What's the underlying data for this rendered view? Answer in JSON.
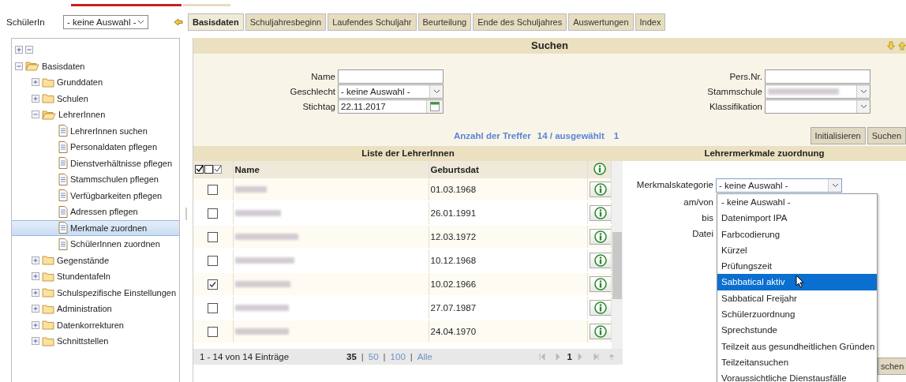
{
  "top": {
    "label": "SchülerIn",
    "select": "- keine Auswahl -"
  },
  "tabs": [
    {
      "label": "Basisdaten",
      "selected": true
    },
    {
      "label": "Schuljahresbeginn",
      "selected": false
    },
    {
      "label": "Laufendes Schuljahr",
      "selected": false
    },
    {
      "label": "Beurteilung",
      "selected": false
    },
    {
      "label": "Ende des Schuljahres",
      "selected": false
    },
    {
      "label": "Auswertungen",
      "selected": false
    },
    {
      "label": "Index",
      "selected": false
    }
  ],
  "tree": [
    {
      "label": "Basisdaten",
      "kind": "folder",
      "expanded": true,
      "selected": false,
      "children": [
        {
          "label": "Grunddaten",
          "kind": "folder",
          "expanded": false,
          "selected": false
        },
        {
          "label": "Schulen",
          "kind": "folder",
          "expanded": false,
          "selected": false
        },
        {
          "label": "LehrerInnen",
          "kind": "folder",
          "expanded": true,
          "selected": false,
          "children": [
            {
              "label": "LehrerInnen suchen",
              "kind": "page",
              "selected": false
            },
            {
              "label": "Personaldaten pflegen",
              "kind": "page",
              "selected": false
            },
            {
              "label": "Dienstverhältnisse pflegen",
              "kind": "page",
              "selected": false
            },
            {
              "label": "Stammschulen pflegen",
              "kind": "page",
              "selected": false
            },
            {
              "label": "Verfügbarkeiten pflegen",
              "kind": "page",
              "selected": false
            },
            {
              "label": "Adressen pflegen",
              "kind": "page",
              "selected": false
            },
            {
              "label": "Merkmale zuordnen",
              "kind": "page",
              "selected": true
            },
            {
              "label": "SchülerInnen zuordnen",
              "kind": "page",
              "selected": false
            }
          ]
        },
        {
          "label": "Gegenstände",
          "kind": "folder",
          "expanded": false,
          "selected": false
        },
        {
          "label": "Stundentafeln",
          "kind": "folder",
          "expanded": false,
          "selected": false
        },
        {
          "label": "Schulspezifische Einstellungen",
          "kind": "folder",
          "expanded": false,
          "selected": false
        },
        {
          "label": "Administration",
          "kind": "folder",
          "expanded": false,
          "selected": false
        },
        {
          "label": "Datenkorrekturen",
          "kind": "folder",
          "expanded": false,
          "selected": false
        },
        {
          "label": "Schnittstellen",
          "kind": "folder",
          "expanded": false,
          "selected": false
        }
      ]
    }
  ],
  "search": {
    "title": "Suchen",
    "left_fields": [
      {
        "label": "Name",
        "kind": "text"
      },
      {
        "label": "Geschlecht",
        "kind": "select",
        "value": "- keine Auswahl -"
      },
      {
        "label": "Stichtag",
        "kind": "date",
        "value": "22.11.2017"
      }
    ],
    "right_fields": [
      {
        "label": "Pers.Nr.",
        "kind": "text"
      },
      {
        "label": "Stammschule",
        "kind": "blurred"
      },
      {
        "label": "Klassifikation",
        "kind": "select"
      }
    ],
    "hits_label": "Anzahl der Treffer",
    "hits": "14 / ausgewählt",
    "selected_count": "1",
    "buttons": [
      "Initialisieren",
      "Suchen"
    ]
  },
  "list": {
    "title": "Liste der LehrerInnen",
    "columns": [
      "Name",
      "Geburtsdat"
    ],
    "rows": [
      {
        "birth": "01.03.1968",
        "checked": false
      },
      {
        "birth": "26.01.1991",
        "checked": false
      },
      {
        "birth": "12.03.1972",
        "checked": false
      },
      {
        "birth": "10.12.1968",
        "checked": false
      },
      {
        "birth": "10.02.1966",
        "checked": true
      },
      {
        "birth": "27.07.1987",
        "checked": false
      },
      {
        "birth": "24.04.1970",
        "checked": false
      }
    ],
    "footer": "1 - 14 von 14 Einträge",
    "page_sizes": [
      {
        "label": "35",
        "selected": true
      },
      {
        "label": "50",
        "selected": false
      },
      {
        "label": "100",
        "selected": false
      },
      {
        "label": "Alle",
        "selected": false
      }
    ],
    "separators": [
      "|",
      "|",
      "|"
    ],
    "page": "1"
  },
  "assign": {
    "title": "Lehrermerkmale zuordnung",
    "labels": [
      "Merkmalskategorie",
      "am/von",
      "bis",
      "Datei"
    ],
    "select": "- keine Auswahl -",
    "options": [
      {
        "label": "- keine Auswahl -",
        "selected": false
      },
      {
        "label": "Datenimport IPA",
        "selected": false
      },
      {
        "label": "Farbcodierung",
        "selected": false
      },
      {
        "label": "Kürzel",
        "selected": false
      },
      {
        "label": "Prüfungszeit",
        "selected": false
      },
      {
        "label": "Sabbatical aktiv",
        "selected": true
      },
      {
        "label": "Sabbatical Freijahr",
        "selected": false
      },
      {
        "label": "Schülerzuordnung",
        "selected": false
      },
      {
        "label": "Sprechstunde",
        "selected": false
      },
      {
        "label": "Teilzeit aus gesundheitlichen Gründen",
        "selected": false
      },
      {
        "label": "Teilzeitansuchen",
        "selected": false
      },
      {
        "label": "Voraussichtliche Dienstausfälle",
        "selected": false
      }
    ],
    "partial_button": "schen"
  }
}
